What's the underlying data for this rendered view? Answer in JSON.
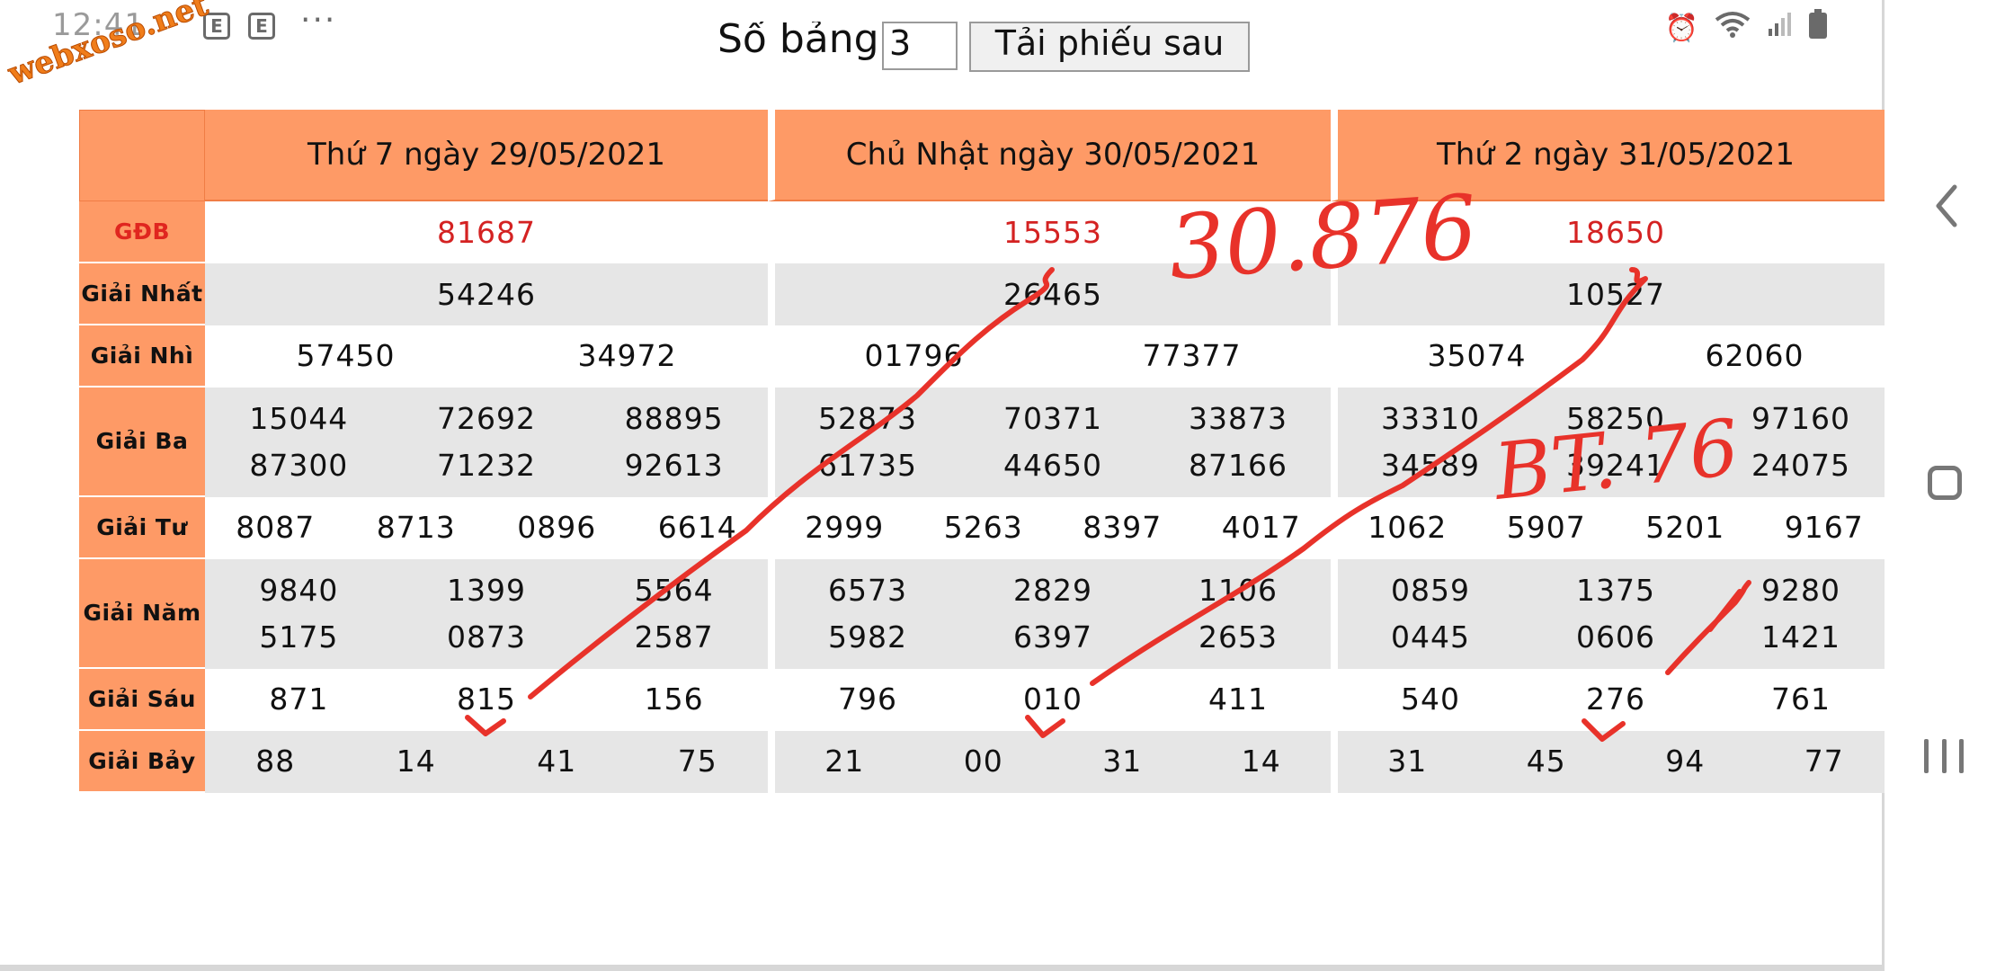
{
  "status_bar": {
    "time": "12:41",
    "notification_icons": [
      "E",
      "E"
    ],
    "more": "···",
    "right_icons": [
      "alarm-icon",
      "wifi-icon",
      "signal-icon",
      "battery-icon"
    ]
  },
  "watermark": "webxoso.net",
  "controls": {
    "so_bang_label": "Số bảng",
    "so_bang_value": "3",
    "reload_label": "Tải phiếu sau"
  },
  "dates": [
    "Thứ 7 ngày 29/05/2021",
    "Chủ Nhật ngày 30/05/2021",
    "Thứ 2 ngày 31/05/2021"
  ],
  "prize_labels": {
    "gdb": "GĐB",
    "nhat": "Giải Nhất",
    "nhi": "Giải Nhì",
    "ba": "Giải Ba",
    "tu": "Giải Tư",
    "nam": "Giải Năm",
    "sau": "Giải Sáu",
    "bay": "Giải Bảy"
  },
  "results": [
    {
      "gdb": "81687",
      "nhat": "54246",
      "nhi": [
        "57450",
        "34972"
      ],
      "ba": [
        "15044",
        "72692",
        "88895",
        "87300",
        "71232",
        "92613"
      ],
      "tu": [
        "8087",
        "8713",
        "0896",
        "6614"
      ],
      "nam": [
        "9840",
        "1399",
        "5564",
        "5175",
        "0873",
        "2587"
      ],
      "sau": [
        "871",
        "815",
        "156"
      ],
      "bay": [
        "88",
        "14",
        "41",
        "75"
      ]
    },
    {
      "gdb": "15553",
      "nhat": "26465",
      "nhi": [
        "01796",
        "77377"
      ],
      "ba": [
        "52873",
        "70371",
        "33873",
        "61735",
        "44650",
        "87166"
      ],
      "tu": [
        "2999",
        "5263",
        "8397",
        "4017"
      ],
      "nam": [
        "6573",
        "2829",
        "1106",
        "5982",
        "6397",
        "2653"
      ],
      "sau": [
        "796",
        "010",
        "411"
      ],
      "bay": [
        "21",
        "00",
        "31",
        "14"
      ]
    },
    {
      "gdb": "18650",
      "nhat": "10527",
      "nhi": [
        "35074",
        "62060"
      ],
      "ba": [
        "33310",
        "58250",
        "97160",
        "34589",
        "39241",
        "24075"
      ],
      "tu": [
        "1062",
        "5907",
        "5201",
        "9167"
      ],
      "nam": [
        "0859",
        "1375",
        "9280",
        "0445",
        "0606",
        "1421"
      ],
      "sau": [
        "540",
        "276",
        "761"
      ],
      "bay": [
        "31",
        "45",
        "94",
        "77"
      ]
    }
  ],
  "annotations": {
    "top_note": "30.876",
    "side_note": "BT. 76"
  },
  "colors": {
    "header_orange": "#fe9a66",
    "ink_red": "#e8322a",
    "gdb_red": "#d42222",
    "row_gray": "#e6e6e6"
  }
}
